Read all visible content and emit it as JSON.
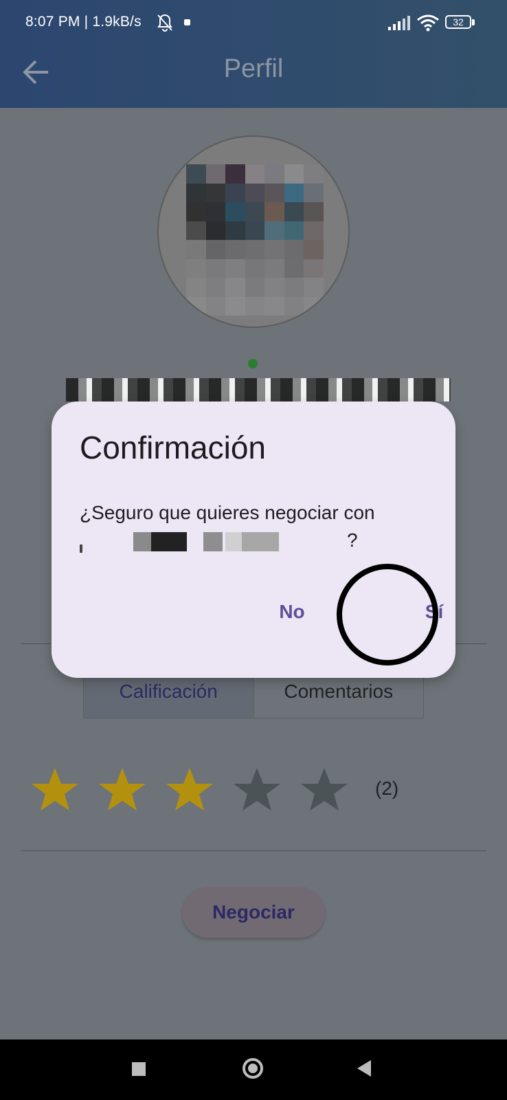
{
  "status_bar": {
    "time_and_speed": "8:07 PM | 1.9kB/s",
    "battery": "32"
  },
  "app_bar": {
    "title": "Perfil"
  },
  "tabs": [
    {
      "label": "Calificación"
    },
    {
      "label": "Comentarios"
    }
  ],
  "rating": {
    "filled_stars": 3,
    "total_stars": 5,
    "count": "(2)",
    "filled_color": "#b3910f",
    "empty_color": "#4b5356"
  },
  "action": {
    "negociar_label": "Negociar"
  },
  "dialog": {
    "title": "Confirmación",
    "message": "¿Seguro que quieres negociar con",
    "message_end": "?",
    "no_label": "No",
    "yes_label": "Sí"
  },
  "colors": {
    "accent": "#5e4e98",
    "appbar": "#2c4670",
    "online": "#2a7d33"
  }
}
